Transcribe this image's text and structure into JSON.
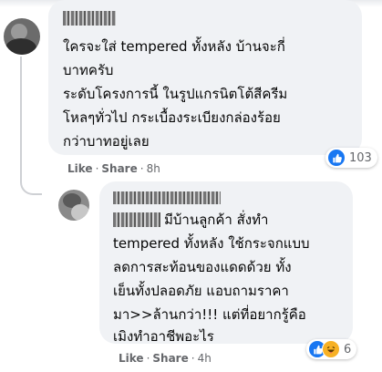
{
  "comments": [
    {
      "text_lines": [
        "ใครจะใส่ tempered ทั้งหลัง บ้านจะกี่",
        "บาทครับ",
        "ระดับโครงการนี้ ในรูปแกรนิตโต้สีครีม",
        "โหลๆทั่วไป กระเบื้องระเบียงกล่องร้อย",
        "กว่าบาทอยู่เลย"
      ],
      "actions": {
        "like": "Like",
        "share": "Share",
        "time": "8h"
      },
      "reactions": {
        "count": "103",
        "icons": [
          "like-icon"
        ]
      }
    },
    {
      "text_lines": [
        "มีบ้านลูกค้า สั่งทำ",
        "tempered ทั้งหลัง ใช้กระจกแบบ",
        "ลดการสะท้อนของแดดด้วย ทั้ง",
        "เย็นทั้งปลอดภัย แอบถามราคา",
        "มา>>ล้านกว่า!!! แต่ที่อยากรู้คือ",
        "เมิงทำอาชีพอะไร"
      ],
      "actions": {
        "like": "Like",
        "share": "Share",
        "time": "4h"
      },
      "reactions": {
        "count": "6",
        "icons": [
          "like-icon",
          "haha-icon"
        ]
      }
    }
  ],
  "separator": "·",
  "colors": {
    "bubble": "#f0f2f5",
    "like_blue": "#1877f2",
    "haha_yellow": "#f7b125",
    "meta_gray": "#65676b"
  }
}
